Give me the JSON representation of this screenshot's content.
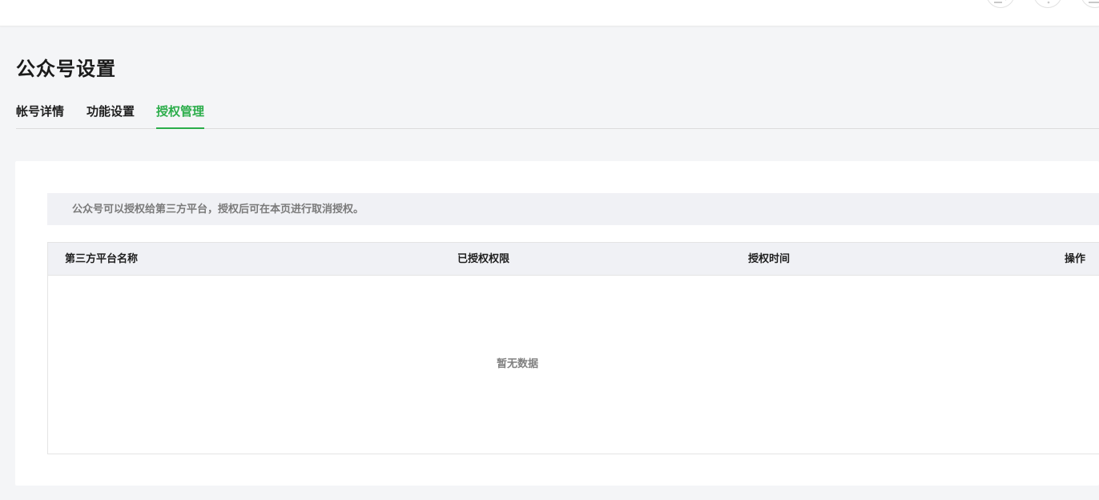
{
  "page_title": "公众号设置",
  "tabs": [
    {
      "label": "帐号详情",
      "active": false
    },
    {
      "label": "功能设置",
      "active": false
    },
    {
      "label": "授权管理",
      "active": true
    }
  ],
  "accent_color": "#2bad4a",
  "topbar": {
    "icons": [
      "switch-icon",
      "help-icon",
      "menu-icon"
    ]
  },
  "authorization": {
    "notice": "公众号可以授权给第三方平台，授权后可在本页进行取消授权。",
    "table": {
      "columns": [
        "第三方平台名称",
        "已授权权限",
        "授权时间",
        "操作"
      ],
      "rows": [],
      "empty_text": "暂无数据"
    }
  }
}
